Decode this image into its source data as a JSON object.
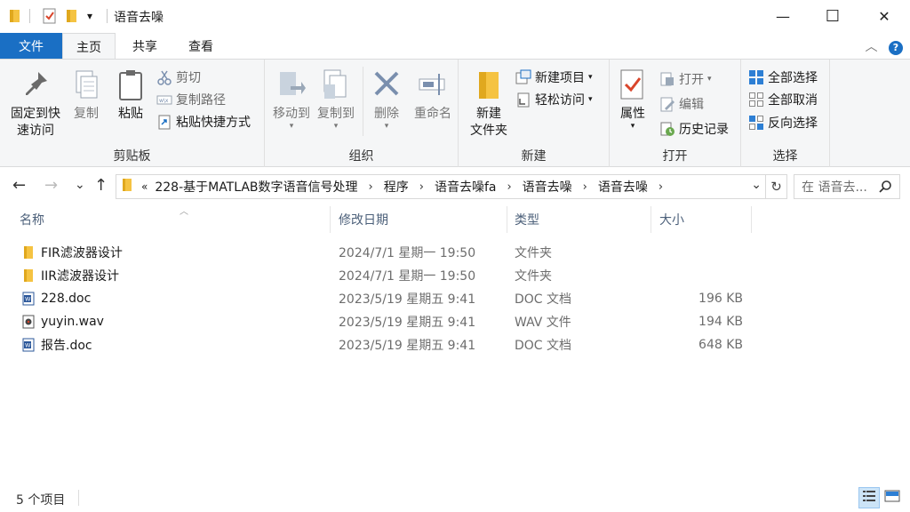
{
  "window": {
    "title": "语音去噪",
    "minimize": "—",
    "maximize": "☐",
    "close": "✕"
  },
  "quick_access": {
    "dropdown": "▾"
  },
  "tabs": [
    {
      "label": "文件"
    },
    {
      "label": "主页"
    },
    {
      "label": "共享"
    },
    {
      "label": "查看"
    }
  ],
  "help": {
    "collapse": "︿",
    "help_icon": "?"
  },
  "ribbon": {
    "clipboard": {
      "label": "剪贴板",
      "pin_label_1": "固定到快",
      "pin_label_2": "速访问",
      "copy": "复制",
      "paste": "粘贴",
      "cut": "剪切",
      "copy_path": "复制路径",
      "paste_shortcut": "粘贴快捷方式"
    },
    "organize": {
      "label": "组织",
      "move_to": "移动到",
      "copy_to": "复制到",
      "delete": "删除",
      "rename": "重命名"
    },
    "new": {
      "label": "新建",
      "new_folder_1": "新建",
      "new_folder_2": "文件夹",
      "new_item": "新建项目",
      "easy_access": "轻松访问"
    },
    "open": {
      "label": "打开",
      "properties": "属性",
      "open": "打开",
      "edit": "编辑",
      "history": "历史记录"
    },
    "select": {
      "label": "选择",
      "select_all": "全部选择",
      "select_none": "全部取消",
      "invert": "反向选择"
    }
  },
  "nav": {
    "back": "←",
    "forward": "→",
    "recent": "⌄",
    "up": "↑",
    "overflow": "«",
    "breadcrumbs": [
      {
        "label": "228-基于MATLAB数字语音信号处理"
      },
      {
        "label": "程序"
      },
      {
        "label": "语音去噪fa"
      },
      {
        "label": "语音去噪"
      },
      {
        "label": "语音去噪"
      }
    ],
    "crumb_sep": "›",
    "addr_dropdown": "⌄",
    "refresh": "↻",
    "search_placeholder": "在 语音去...",
    "search_icon": "⚲"
  },
  "columns": {
    "name": "名称",
    "modified": "修改日期",
    "type": "类型",
    "size": "大小",
    "sort_indicator": "︿"
  },
  "files": [
    {
      "name": "FIR滤波器设计",
      "modified": "2024/7/1 星期一 19:50",
      "type": "文件夹",
      "size": "",
      "icon": "folder"
    },
    {
      "name": "IIR滤波器设计",
      "modified": "2024/7/1 星期一 19:50",
      "type": "文件夹",
      "size": "",
      "icon": "folder"
    },
    {
      "name": "228.doc",
      "modified": "2023/5/19 星期五 9:41",
      "type": "DOC 文档",
      "size": "196 KB",
      "icon": "word-doc"
    },
    {
      "name": "yuyin.wav",
      "modified": "2023/5/19 星期五 9:41",
      "type": "WAV 文件",
      "size": "194 KB",
      "icon": "audio-file"
    },
    {
      "name": "报告.doc",
      "modified": "2023/5/19 星期五 9:41",
      "type": "DOC 文档",
      "size": "648 KB",
      "icon": "word-doc"
    }
  ],
  "status": {
    "item_count": "5 个项目"
  },
  "colors": {
    "accent": "#1a6fc4",
    "folder": "#f5c342",
    "ribbon_bg": "#f5f6f7"
  }
}
